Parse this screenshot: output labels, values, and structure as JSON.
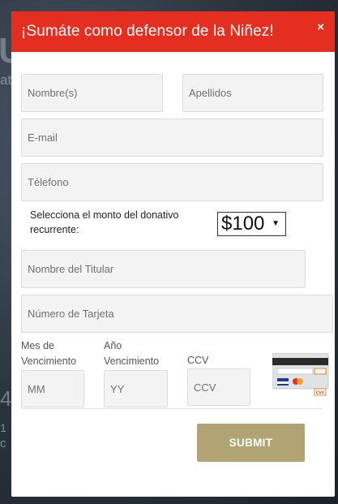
{
  "background": {
    "fragments": [
      "U",
      "ate",
      "4",
      "1",
      "c"
    ]
  },
  "modal": {
    "title": "¡Sumáte como defensor de la Niñez!",
    "close_label": "×",
    "header_color": "#e42e1f"
  },
  "form": {
    "first_name_placeholder": "Nombre(s)",
    "last_name_placeholder": "Apellidos",
    "email_placeholder": "E-mail",
    "phone_placeholder": "Télefono",
    "amount_label": "Selecciona el monto del donativo recurrente:",
    "amount_value": "$100",
    "cardholder_placeholder": "Nombre del Titular",
    "card_number_placeholder": "Número de Tarjeta",
    "exp_month_label": "Mes de Vencimiento",
    "exp_month_placeholder": "MM",
    "exp_year_label": "Año Vencimiento",
    "exp_year_placeholder": "YY",
    "ccv_label": "CCV",
    "ccv_placeholder": "CCV",
    "card_image_label": "CVV",
    "submit_label": "SUBMIT",
    "submit_color": "#b2a374"
  }
}
